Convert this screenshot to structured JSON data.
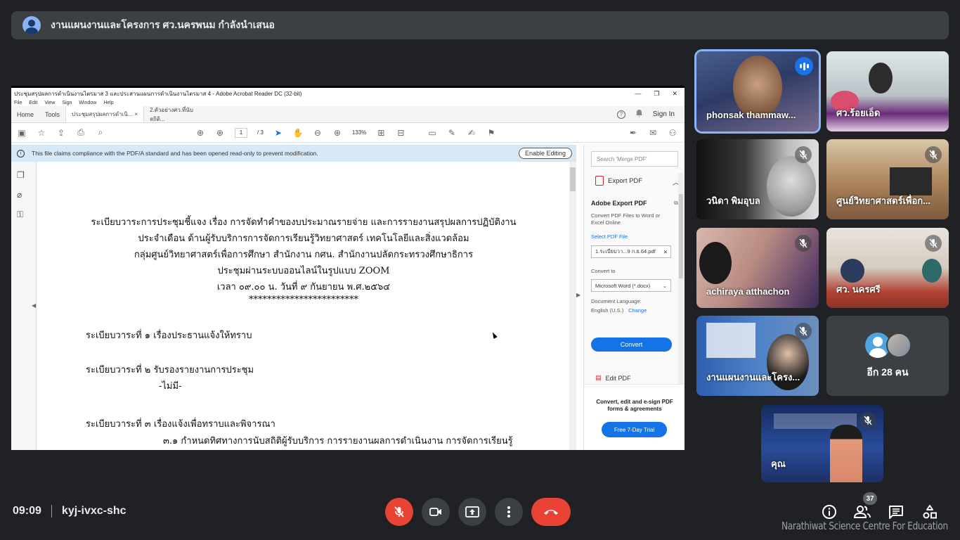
{
  "banner": {
    "text": "งานแผนงานและโครงการ ศว.นครพนม กำลังนำเสนอ"
  },
  "acrobat": {
    "window_title": "ประชุมสรุปผลการดำเนินงานไตรมาส 3 และประสานแผนการดำเนินงานไตรมาส 4 - Adobe Acrobat Reader DC (32-bit)",
    "menu": [
      "File",
      "Edit",
      "View",
      "Sign",
      "Window",
      "Help"
    ],
    "tabs": {
      "home": "Home",
      "tools": "Tools",
      "doc1": "ประชุมสรุปผลการดำเนิ...",
      "doc2": "2.ตัวอย่างศว.ที่นับสถิติ..."
    },
    "sign_in": "Sign In",
    "page_current": "1",
    "page_total": "/ 3",
    "zoom": "133%",
    "info_message": "This file claims compliance with the PDF/A standard and has been opened read-only to prevent modification.",
    "enable_editing": "Enable Editing",
    "document": {
      "header": [
        "ระเบียบวาระการประชุมชี้แจง เรื่อง การจัดทำคำของบประมาณรายจ่าย และการรายงานสรุปผลการปฏิบัติงาน",
        "ประจำเดือน ด้านผู้รับบริการการจัดการเรียนรู้วิทยาศาสตร์ เทคโนโลยีและสิ่งแวดล้อม",
        "กลุ่มศูนย์วิทยาศาสตร์เพื่อการศึกษา สำนักงาน กศน. สำนักงานปลัดกระทรวงศึกษาธิการ",
        "ประชุมผ่านระบบออนไลน์ในรูปแบบ ZOOM",
        "เวลา ๐๙.๐๐ น. วันที่ ๙ กันยายน พ.ศ.๒๕๖๔",
        "************************"
      ],
      "agenda1": "ระเบียบวาระที่ ๑  เรื่องประธานแจ้งให้ทราบ",
      "agenda2": "ระเบียบวาระที่ ๒  รับรองรายงานการประชุม",
      "agenda2_note": "-ไม่มี-",
      "agenda3": "ระเบียบวาระที่ ๓  เรื่องแจ้งเพื่อทราบและพิจารณา",
      "item31": "๓.๑    กำหนดทิศทางการนับสถิติผู้รับบริการ การรายงานผลการดำเนินงาน การจัดการเรียนรู้"
    },
    "right_pane": {
      "search_placeholder": "Search 'Merge PDF'",
      "export_pdf": "Export PDF",
      "adobe_export": "Adobe Export PDF",
      "convert_desc": "Convert PDF Files to Word or Excel Online",
      "select_file": "Select PDF File",
      "file_name": "1.ระเบียบวา...9 ก.ย.64.pdf",
      "convert_to": "Convert to",
      "format": "Microsoft Word (*.docx)",
      "doc_language": "Document Language:",
      "language": "English (U.S.)",
      "change": "Change",
      "convert_btn": "Convert",
      "edit_pdf": "Edit PDF",
      "promo": "Convert, edit and e-sign PDF forms & agreements",
      "trial": "Free 7-Day Trial"
    }
  },
  "participants": [
    {
      "name": "phonsak thammaw...",
      "speaking": true
    },
    {
      "name": "ศว.ร้อยเอ็ด"
    },
    {
      "name": "วนิดา พิมอุบล",
      "muted": true
    },
    {
      "name": "ศูนย์วิทยาศาสตร์เพื่อก...",
      "muted": true
    },
    {
      "name": "achiraya atthachon",
      "muted": true
    },
    {
      "name": "ศว. นครศรี",
      "muted": true
    },
    {
      "name": "งานแผนงานและโครง...",
      "muted": true
    },
    {
      "name": "คุณ",
      "muted": true
    }
  ],
  "others": {
    "label": "อีก 28 คน"
  },
  "meeting": {
    "time": "09:09",
    "code": "kyj-ivxc-shc",
    "participant_count": "37"
  },
  "watermark": "Narathiwat Science Centre For Education",
  "colors": {
    "background": "#202124",
    "tile": "#3c4043",
    "end_call": "#ea4335",
    "active_speaker": "#8ab4f8",
    "acrobat_blue": "#1473e6"
  }
}
